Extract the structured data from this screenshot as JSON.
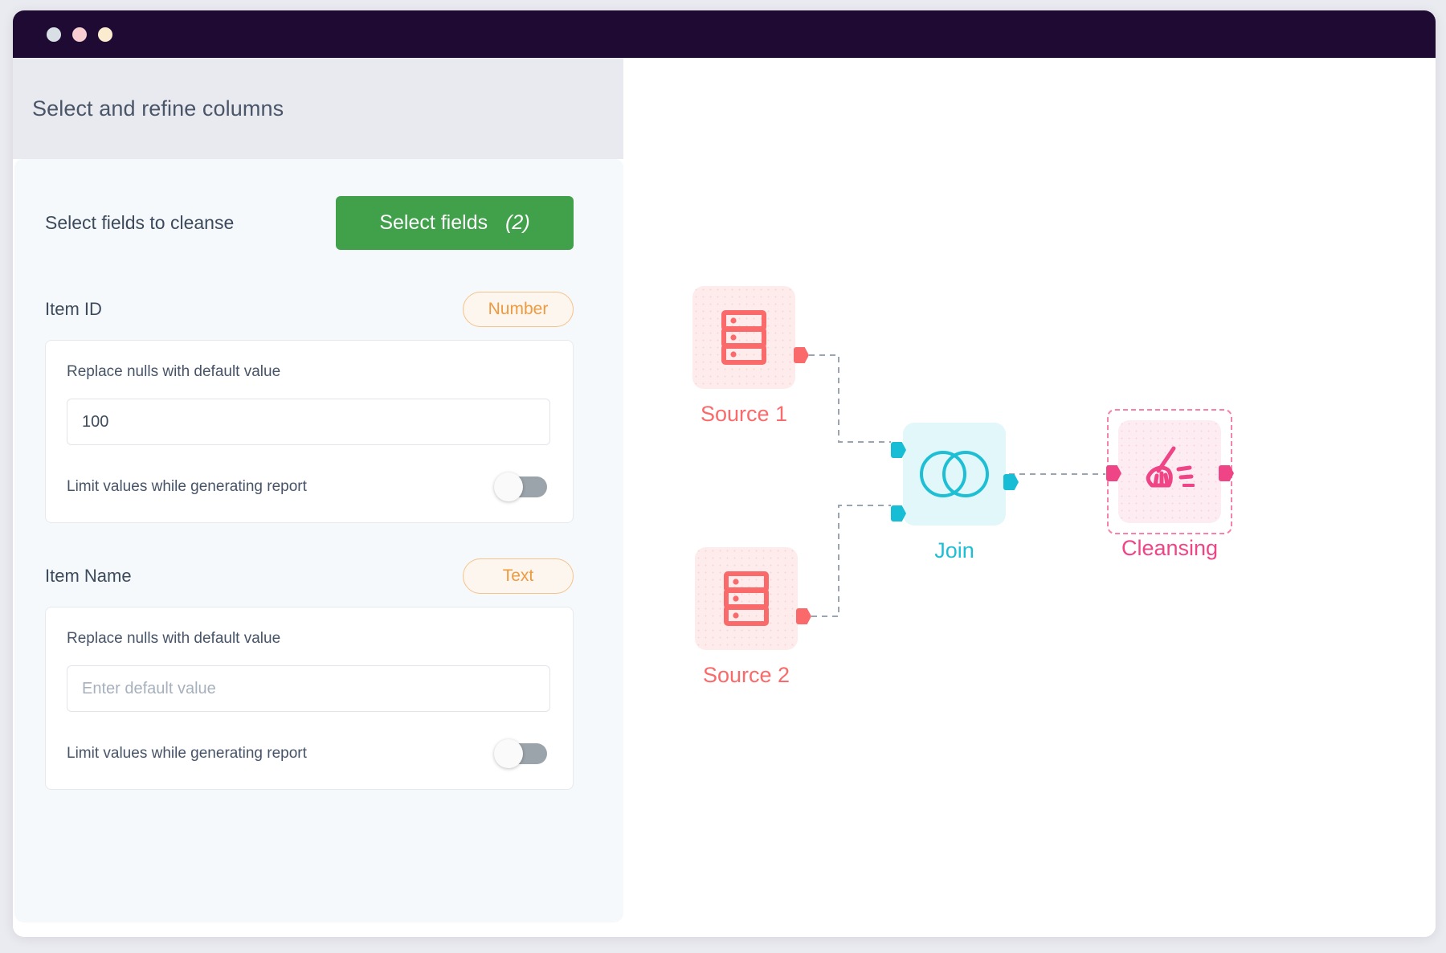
{
  "window": {
    "controls": [
      {
        "name": "close-dot",
        "color": "#d9e0e5"
      },
      {
        "name": "minimize-dot",
        "color": "#f9ced2"
      },
      {
        "name": "maximize-dot",
        "color": "#fbeccf"
      }
    ]
  },
  "panel": {
    "title": "Select and refine columns",
    "select_label": "Select fields to cleanse",
    "select_button": {
      "label": "Select fields",
      "count": "(2)",
      "color": "#41a14b"
    }
  },
  "fields": [
    {
      "name": "Item ID",
      "type_badge": "Number",
      "default_value_label": "Replace nulls with default value",
      "default_value": "100",
      "default_placeholder": "Enter default value",
      "toggle_label": "Limit values while generating report",
      "toggle_on": false
    },
    {
      "name": "Item Name",
      "type_badge": "Text",
      "default_value_label": "Replace nulls with default value",
      "default_value": "",
      "default_placeholder": "Enter default value",
      "toggle_label": "Limit values while generating report",
      "toggle_on": false
    }
  ],
  "flow": {
    "nodes": [
      {
        "id": "source1",
        "label": "Source 1",
        "icon": "database-icon",
        "color": "#fa6a6a",
        "selected": false
      },
      {
        "id": "source2",
        "label": "Source 2",
        "icon": "database-icon",
        "color": "#fa6a6a",
        "selected": false
      },
      {
        "id": "join",
        "label": "Join",
        "icon": "venn-circles-icon",
        "color": "#1ebfd4",
        "selected": false
      },
      {
        "id": "cleansing",
        "label": "Cleansing",
        "icon": "broom-icon",
        "color": "#ef4486",
        "selected": true
      }
    ],
    "connections": [
      {
        "from": "source1",
        "to": "join"
      },
      {
        "from": "source2",
        "to": "join"
      },
      {
        "from": "join",
        "to": "cleansing"
      }
    ]
  }
}
